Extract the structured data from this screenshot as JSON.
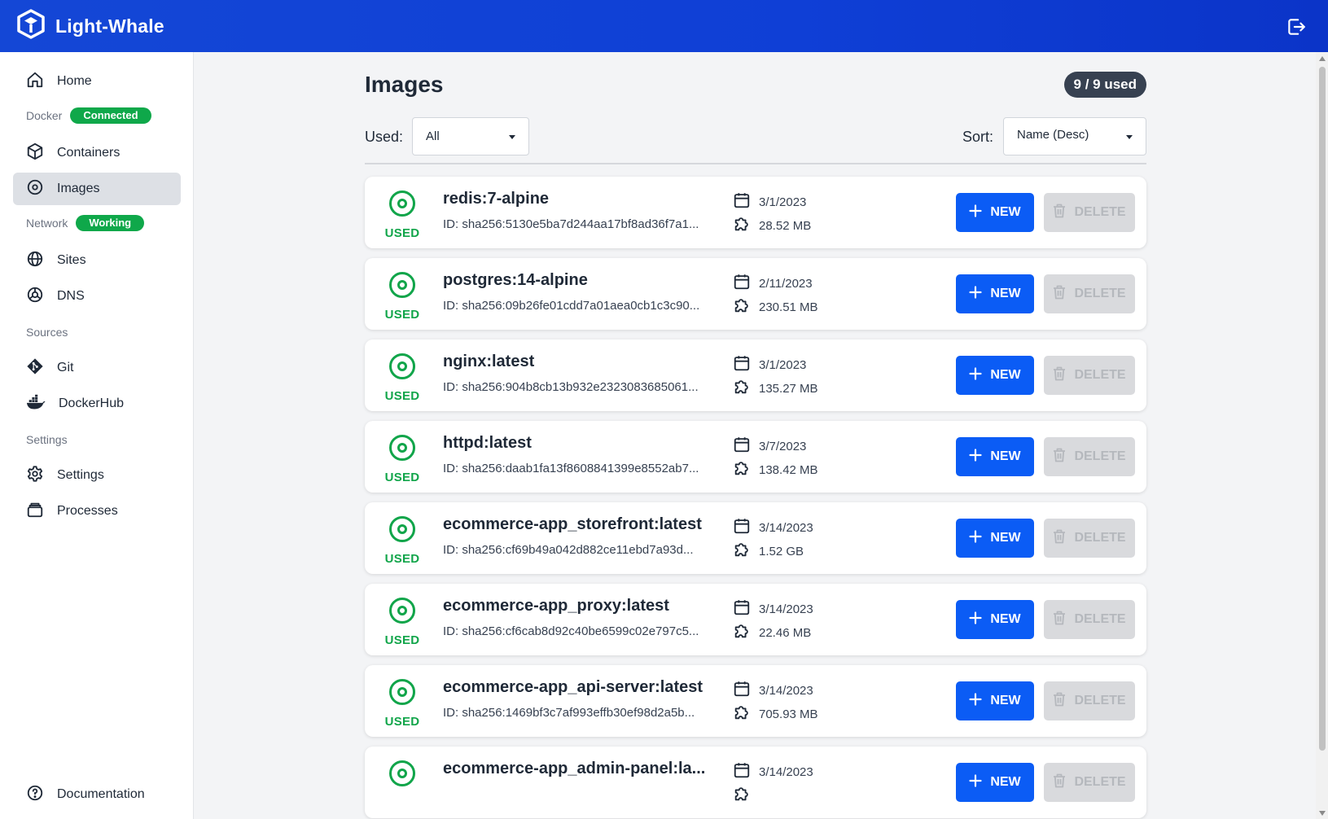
{
  "app": {
    "title": "Light-Whale"
  },
  "sidebar": {
    "home": "Home",
    "docker_section": "Docker",
    "docker_status": "Connected",
    "containers": "Containers",
    "images": "Images",
    "network_section": "Network",
    "network_status": "Working",
    "sites": "Sites",
    "dns": "DNS",
    "sources_section": "Sources",
    "git": "Git",
    "dockerhub": "DockerHub",
    "settings_section": "Settings",
    "settings": "Settings",
    "processes": "Processes",
    "documentation": "Documentation"
  },
  "main": {
    "title": "Images",
    "used_badge": "9 / 9 used",
    "used_label": "Used:",
    "used_value": "All",
    "sort_label": "Sort:",
    "sort_value": "Name (Desc)"
  },
  "images": [
    {
      "status": "USED",
      "name": "redis:7-alpine",
      "id": "ID: sha256:5130e5ba7d244aa17bf8ad36f7a1...",
      "date": "3/1/2023",
      "size": "28.52 MB",
      "new": "NEW",
      "delete": "DELETE"
    },
    {
      "status": "USED",
      "name": "postgres:14-alpine",
      "id": "ID: sha256:09b26fe01cdd7a01aea0cb1c3c90...",
      "date": "2/11/2023",
      "size": "230.51 MB",
      "new": "NEW",
      "delete": "DELETE"
    },
    {
      "status": "USED",
      "name": "nginx:latest",
      "id": "ID: sha256:904b8cb13b932e2323083685061...",
      "date": "3/1/2023",
      "size": "135.27 MB",
      "new": "NEW",
      "delete": "DELETE"
    },
    {
      "status": "USED",
      "name": "httpd:latest",
      "id": "ID: sha256:daab1fa13f8608841399e8552ab7...",
      "date": "3/7/2023",
      "size": "138.42 MB",
      "new": "NEW",
      "delete": "DELETE"
    },
    {
      "status": "USED",
      "name": "ecommerce-app_storefront:latest",
      "id": "ID: sha256:cf69b49a042d882ce11ebd7a93d...",
      "date": "3/14/2023",
      "size": "1.52 GB",
      "new": "NEW",
      "delete": "DELETE"
    },
    {
      "status": "USED",
      "name": "ecommerce-app_proxy:latest",
      "id": "ID: sha256:cf6cab8d92c40be6599c02e797c5...",
      "date": "3/14/2023",
      "size": "22.46 MB",
      "new": "NEW",
      "delete": "DELETE"
    },
    {
      "status": "USED",
      "name": "ecommerce-app_api-server:latest",
      "id": "ID: sha256:1469bf3c7af993effb30ef98d2a5b...",
      "date": "3/14/2023",
      "size": "705.93 MB",
      "new": "NEW",
      "delete": "DELETE"
    },
    {
      "status": "",
      "name": "ecommerce-app_admin-panel:la...",
      "id": "",
      "date": "3/14/2023",
      "size": "",
      "new": "NEW",
      "delete": "DELETE"
    }
  ],
  "colors": {
    "header": "#1447d6",
    "accent": "#0b5cf5",
    "used": "#11a54a",
    "pill": "#0fa84a"
  },
  "icons": {
    "logo": "whale-cube-icon",
    "logout": "logout-icon",
    "status": "target-icon",
    "date": "calendar-icon",
    "size": "puzzle-icon",
    "new": "plus-icon",
    "delete": "trash-icon"
  }
}
